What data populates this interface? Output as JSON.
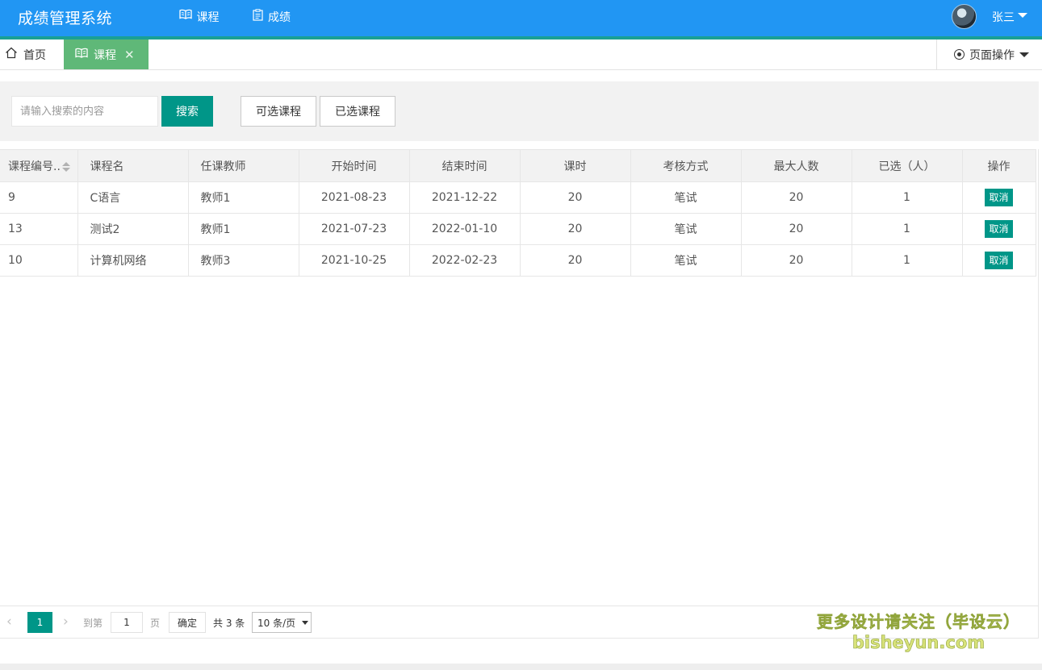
{
  "app": {
    "title": "成绩管理系统"
  },
  "nav": [
    {
      "label": "课程",
      "icon": "book-open-icon",
      "active": true
    },
    {
      "label": "成绩",
      "icon": "clipboard-icon",
      "active": false
    }
  ],
  "user": {
    "name": "张三"
  },
  "tabs": {
    "home": "首页",
    "current": "课程",
    "page_ops": "页面操作"
  },
  "toolbar": {
    "search_placeholder": "请输入搜索的内容",
    "search_label": "搜索",
    "optional_label": "可选课程",
    "selected_label": "已选课程"
  },
  "table": {
    "headers": [
      "课程编号..",
      "课程名",
      "任课教师",
      "开始时间",
      "结束时间",
      "课时",
      "考核方式",
      "最大人数",
      "已选（人）",
      "操作"
    ],
    "rows": [
      [
        "9",
        "C语言",
        "教师1",
        "2021-08-23",
        "2021-12-22",
        "20",
        "笔试",
        "20",
        "1",
        "取消"
      ],
      [
        "13",
        "测试2",
        "教师1",
        "2021-07-23",
        "2022-01-10",
        "20",
        "笔试",
        "20",
        "1",
        "取消"
      ],
      [
        "10",
        "计算机网络",
        "教师3",
        "2021-10-25",
        "2022-02-23",
        "20",
        "笔试",
        "20",
        "1",
        "取消"
      ]
    ]
  },
  "pagination": {
    "current_page": "1",
    "goto_label": "到第",
    "goto_value": "1",
    "page_suffix": "页",
    "confirm_label": "确定",
    "total_text": "共 3 条",
    "page_size": "10 条/页"
  },
  "watermark": {
    "line1": "更多设计请关注（毕设云）",
    "line2": "bisheyun.com"
  },
  "colors": {
    "header": "#2196f3",
    "strip": "#1aa094",
    "accent": "#009688",
    "active_tab": "#5fb878"
  }
}
